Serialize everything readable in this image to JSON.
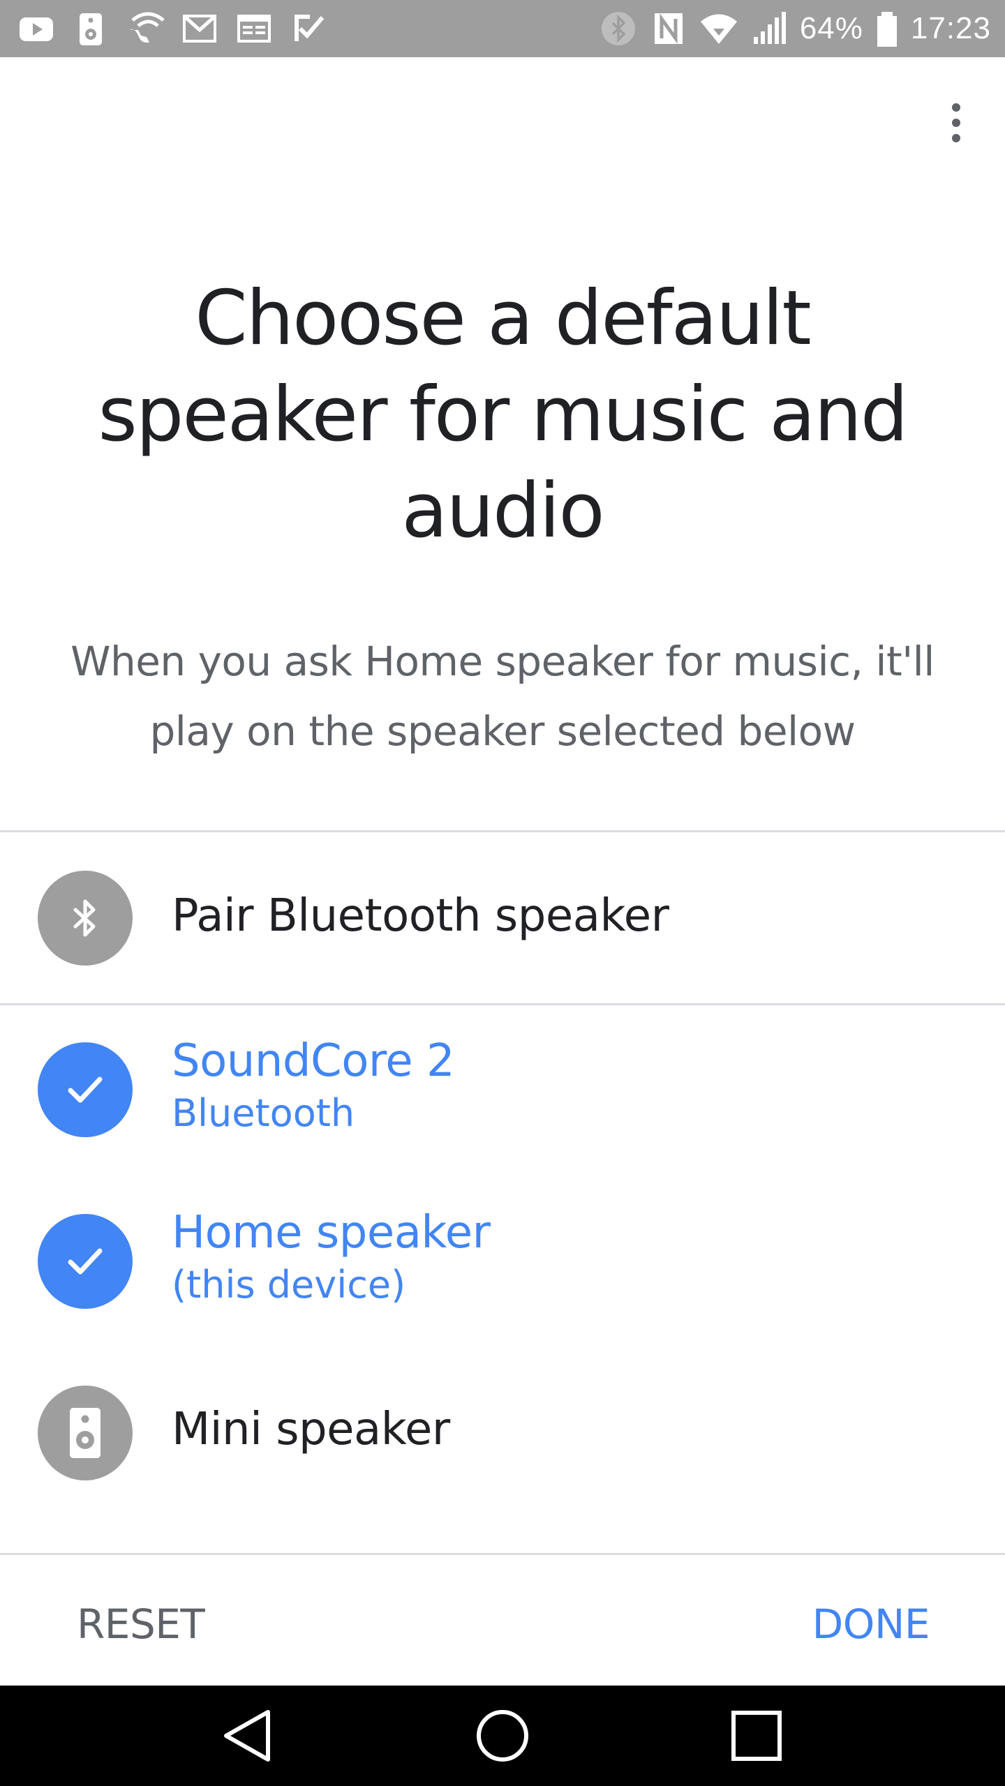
{
  "status_bar": {
    "battery_percent": "64%",
    "time": "17:23",
    "left_icons": [
      "youtube-icon",
      "speaker-icon",
      "wifi-calling-icon",
      "gmail-icon",
      "news-icon",
      "tasks-icon"
    ],
    "right_icons": [
      "bluetooth-icon",
      "nfc-icon",
      "wifi-icon",
      "signal-icon",
      "battery-icon"
    ]
  },
  "header": {
    "menu_icon": "more-vert-icon"
  },
  "main": {
    "title": "Choose a default speaker for music and audio",
    "subtitle": "When you ask Home speaker for music, it'll play on the speaker selected below"
  },
  "list": {
    "pair": {
      "label": "Pair Bluetooth speaker",
      "icon": "bluetooth-icon"
    },
    "devices": [
      {
        "name": "SoundCore 2",
        "detail": "Bluetooth",
        "selected": true,
        "icon": "check-icon"
      },
      {
        "name": "Home speaker",
        "detail": "(this device)",
        "selected": true,
        "icon": "check-icon"
      },
      {
        "name": "Mini speaker",
        "detail": "",
        "selected": false,
        "icon": "speaker-icon"
      }
    ]
  },
  "actions": {
    "reset_label": "RESET",
    "done_label": "DONE"
  },
  "nav_bar": {
    "icons": [
      "back-icon",
      "home-icon",
      "recents-icon"
    ]
  },
  "colors": {
    "accent": "#4285f4",
    "status_bar_bg": "#9e9e9e",
    "icon_grey": "#9e9e9e",
    "title_text": "#202124",
    "secondary_text": "#5f6368",
    "divider": "#dadce0",
    "nav_bar_bg": "#000000"
  }
}
